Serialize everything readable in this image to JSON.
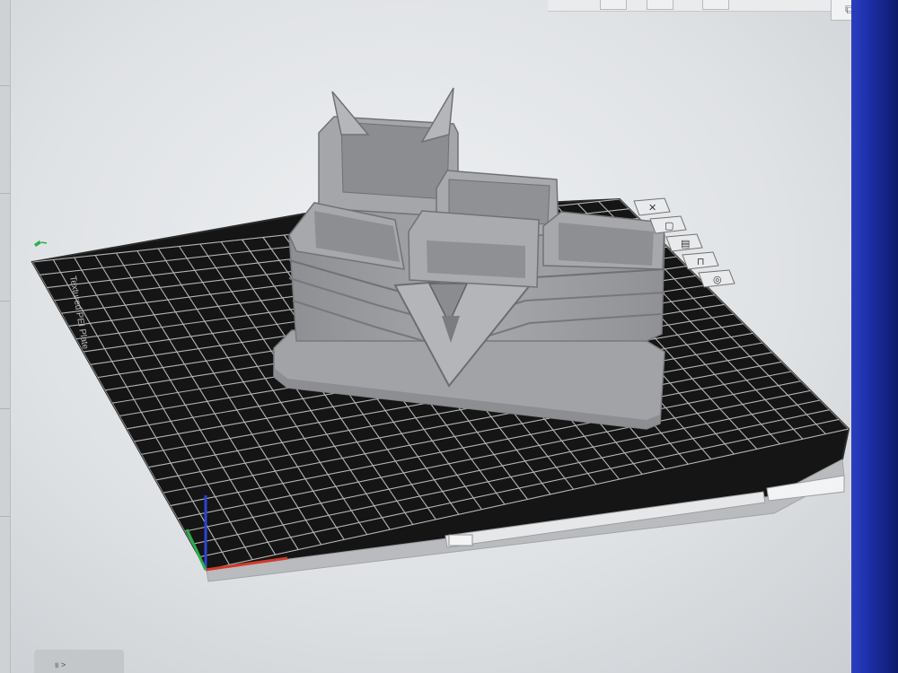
{
  "window": {
    "topbar_icon": "layout-icon",
    "bottom_left_label": "॥ >"
  },
  "bed": {
    "edge_label": "Textured PEI Plate",
    "grid_color": "#cfcfcf",
    "surface_color": "#161616"
  },
  "model": {
    "color": "#9a9c9f",
    "name": "tiered-organizer-box"
  },
  "toolbar": {
    "tools": [
      {
        "name": "delete-plate-icon",
        "glyph": "✕"
      },
      {
        "name": "auto-arrange-icon",
        "glyph": "▢"
      },
      {
        "name": "orient-icon",
        "glyph": "▤"
      },
      {
        "name": "lock-plate-icon",
        "glyph": "⊓"
      },
      {
        "name": "plate-settings-icon",
        "glyph": "◎"
      }
    ]
  },
  "axes": {
    "x_color": "#d43a2a",
    "y_color": "#2ab04a",
    "z_color": "#2a45d4"
  }
}
